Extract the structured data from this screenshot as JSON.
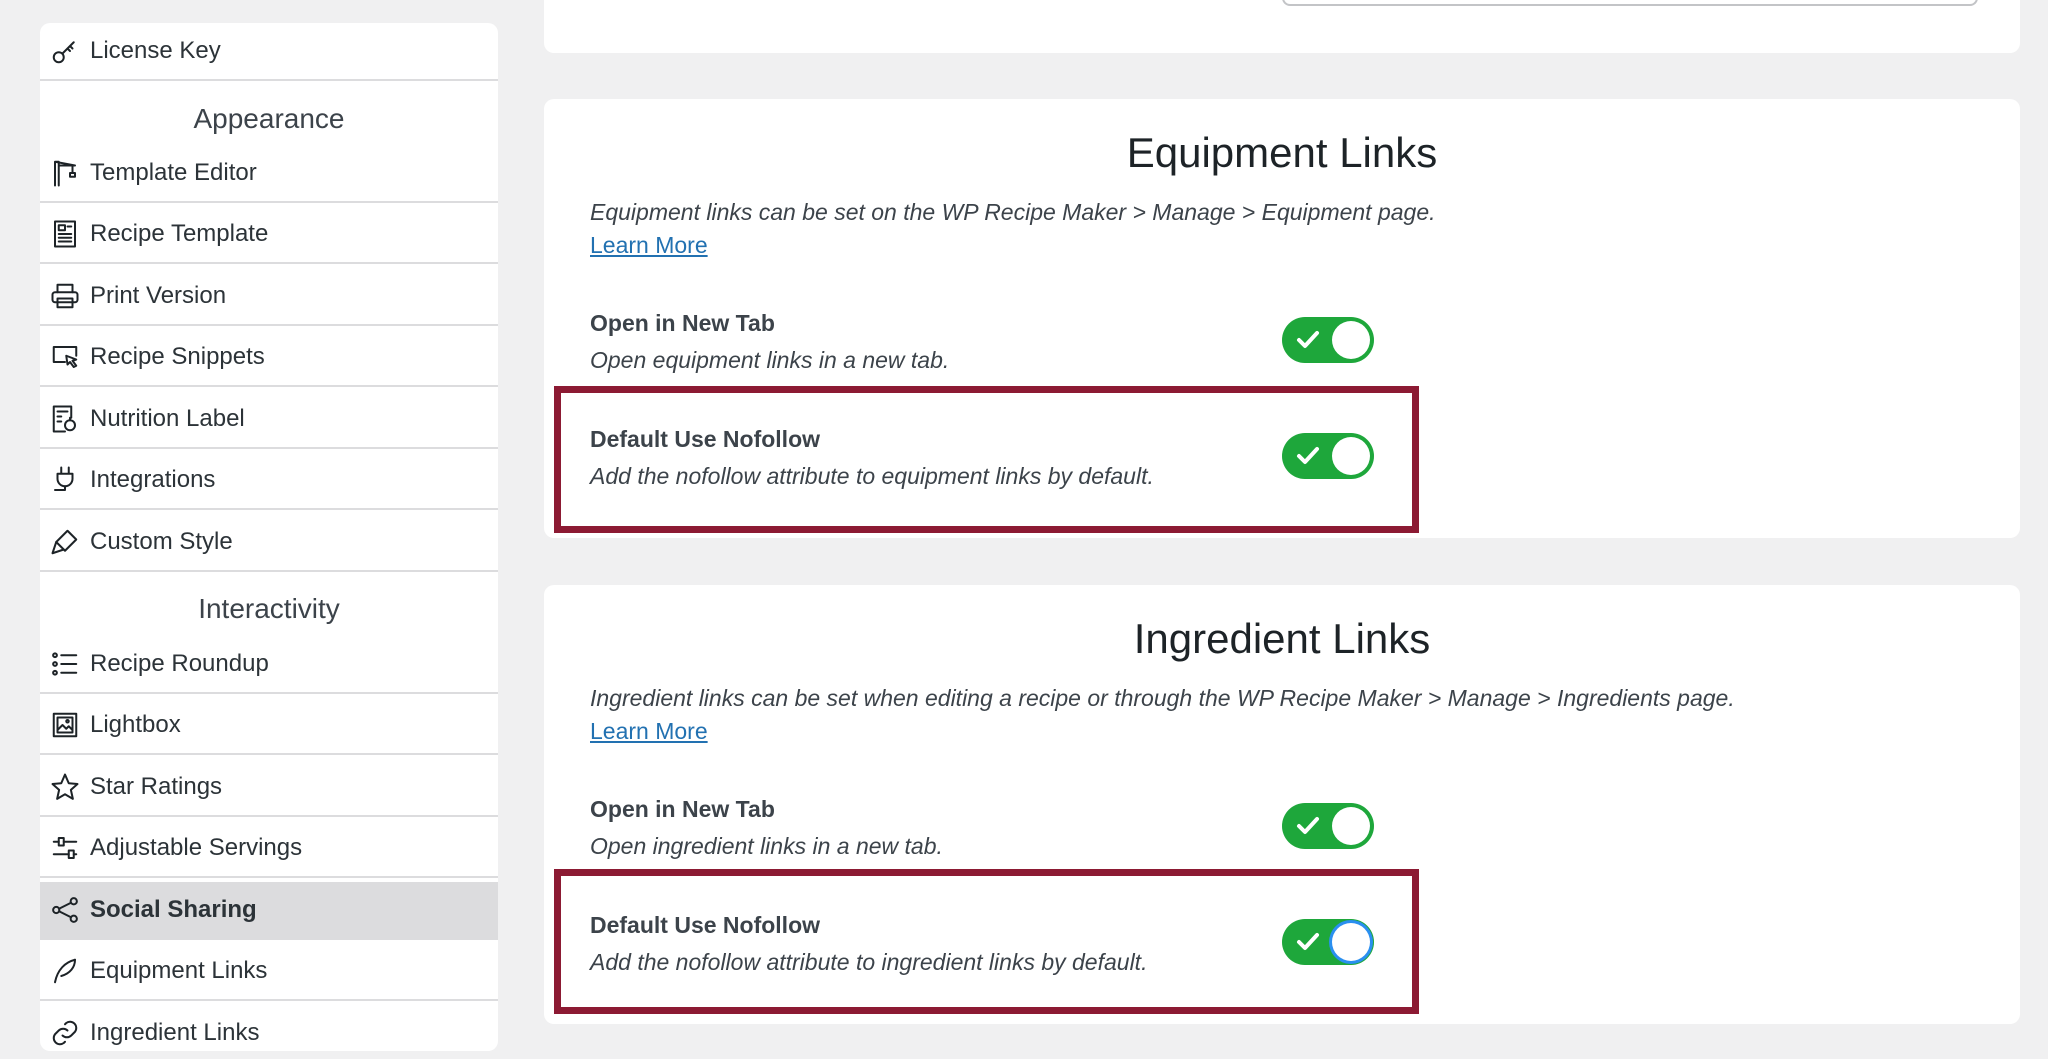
{
  "sidebar": {
    "license_key": "License Key",
    "appearance_heading": "Appearance",
    "template_editor": "Template Editor",
    "recipe_template": "Recipe Template",
    "print_version": "Print Version",
    "recipe_snippets": "Recipe Snippets",
    "nutrition_label": "Nutrition Label",
    "integrations": "Integrations",
    "custom_style": "Custom Style",
    "interactivity_heading": "Interactivity",
    "recipe_roundup": "Recipe Roundup",
    "lightbox": "Lightbox",
    "star_ratings": "Star Ratings",
    "adjustable_servings": "Adjustable Servings",
    "social_sharing": "Social Sharing",
    "equipment_links": "Equipment Links",
    "ingredient_links": "Ingredient Links"
  },
  "equipment": {
    "title": "Equipment Links",
    "description": "Equipment links can be set on the WP Recipe Maker > Manage > Equipment page.",
    "learn_more": "Learn More",
    "new_tab_title": "Open in New Tab",
    "new_tab_desc": "Open equipment links in a new tab.",
    "new_tab_on": true,
    "nofollow_title": "Default Use Nofollow",
    "nofollow_desc": "Add the nofollow attribute to equipment links by default.",
    "nofollow_on": true
  },
  "ingredient": {
    "title": "Ingredient Links",
    "description": "Ingredient links can be set when editing a recipe or through the WP Recipe Maker > Manage > Ingredients page.",
    "learn_more": "Learn More",
    "new_tab_title": "Open in New Tab",
    "new_tab_desc": "Open ingredient links in a new tab.",
    "new_tab_on": true,
    "nofollow_title": "Default Use Nofollow",
    "nofollow_desc": "Add the nofollow attribute to ingredient links by default.",
    "nofollow_on": true
  },
  "colors": {
    "toggle_on": "#1ea73b",
    "highlight": "#8c1a33",
    "link": "#2271b1",
    "active_item": "#dcdcde"
  }
}
